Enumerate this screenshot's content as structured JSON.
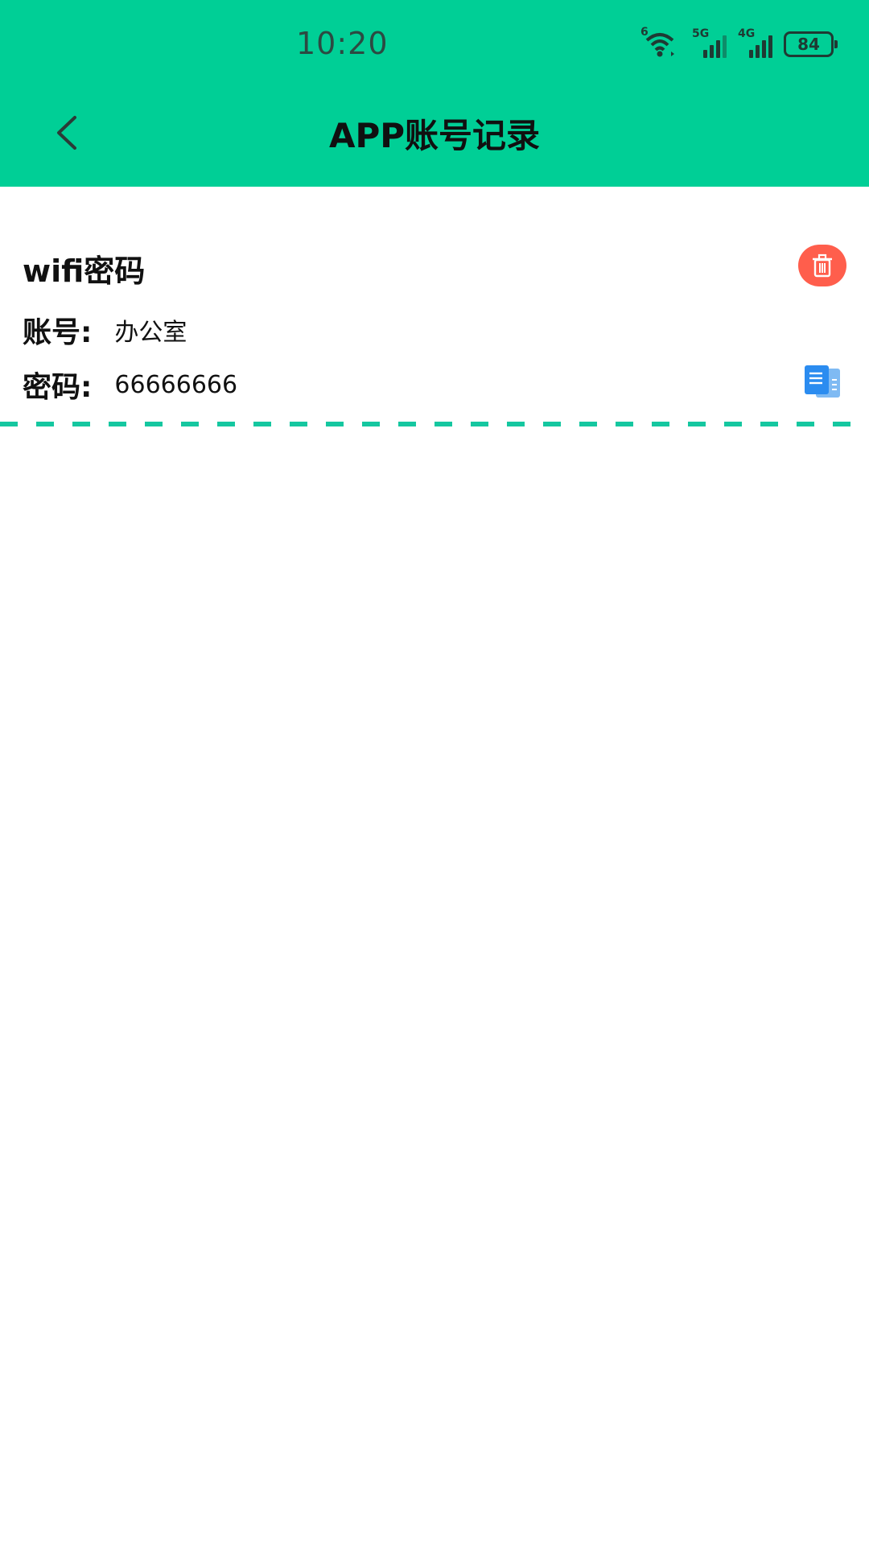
{
  "status_bar": {
    "time": "10:20",
    "battery": "84",
    "wifi_badge": "6",
    "signal1_badge": "5G",
    "signal2_badge": "4G"
  },
  "header": {
    "title": "APP账号记录",
    "back_icon": "chevron-left-icon"
  },
  "record": {
    "title": "wifi密码",
    "account_label": "账号:",
    "account_value": "办公室",
    "password_label": "密码:",
    "password_value": "66666666",
    "delete_icon": "trash-icon",
    "copy_icon": "copy-icon"
  },
  "colors": {
    "header": "#00cf96",
    "delete": "#ff5e4c",
    "divider": "#15c7a0",
    "copy": "#2b8cf0"
  }
}
